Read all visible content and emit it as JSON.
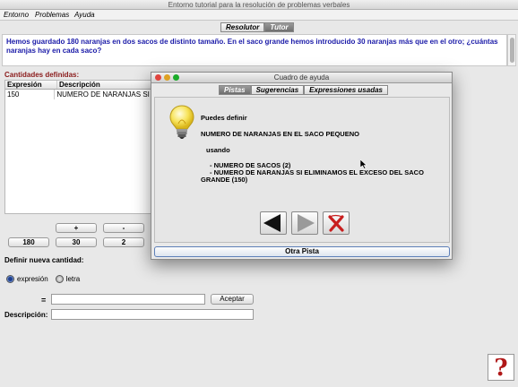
{
  "window": {
    "title": "Entorno tutorial para la resolución de problemas verbales"
  },
  "menu": [
    "Entorno",
    "Problemas",
    "Ayuda"
  ],
  "main_tabs": [
    {
      "label": "Resolutor",
      "active": false
    },
    {
      "label": "Tutor",
      "active": true
    }
  ],
  "problem_text": "Hemos guardado 180 naranjas en dos sacos de distinto tamaño. En el saco grande hemos introducido 30 naranjas más que en el otro; ¿cuántas naranjas hay en cada saco?",
  "quantities": {
    "label": "Cantidades definidas:",
    "columns": [
      "Expresión",
      "Descripción"
    ],
    "rows": [
      {
        "expr": "150",
        "desc": "NUMERO DE NARANJAS SI E"
      }
    ]
  },
  "operator_buttons": [
    "+",
    "-"
  ],
  "number_buttons": [
    "180",
    "30",
    "2"
  ],
  "define": {
    "label": "Definir nueva cantidad:",
    "options": [
      {
        "label": "expresión",
        "selected": true
      },
      {
        "label": "letra",
        "selected": false
      }
    ],
    "equals": "=",
    "accept_label": "Aceptar",
    "description_label": "Descripción:",
    "expression_value": "",
    "description_value": ""
  },
  "help_button": "?",
  "dialog": {
    "title": "Cuadro de ayuda",
    "tabs": [
      {
        "label": "Pistas",
        "active": true
      },
      {
        "label": "Sugerencias",
        "active": false
      },
      {
        "label": "Expressiones usadas",
        "active": false
      }
    ],
    "hint": {
      "intro": "Puedes definir",
      "target": "NUMERO DE NARANJAS EN EL SACO PEQUENO",
      "using": "usando",
      "item1": "- NUMERO DE SACOS (2)",
      "item2": "- NUMERO DE NARANJAS SI ELIMINAMOS EL EXCESO DEL SACO",
      "item2_cont": "GRANDE (150)"
    },
    "next_hint_label": "Otra Pista",
    "icons": [
      "lightbulb-icon",
      "back-arrow-icon",
      "forward-arrow-icon",
      "close-x-icon"
    ]
  },
  "colors": {
    "problem_text": "#1a1aa8",
    "quantities_label": "#8a1a1a",
    "help_question": "#b01818"
  }
}
